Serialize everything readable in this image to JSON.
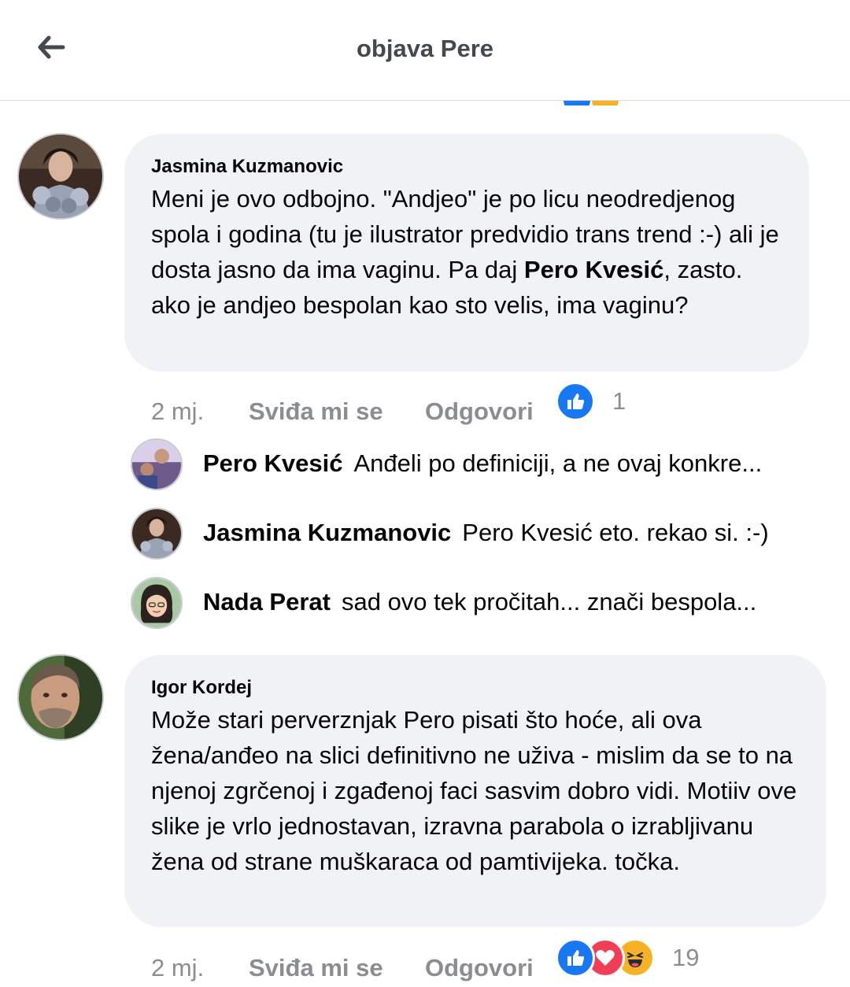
{
  "header": {
    "title": "objava Pere",
    "back_icon": "arrow-left-icon"
  },
  "comments": [
    {
      "author": "Jasmina Kuzmanovic",
      "text_before": "Meni je ovo odbojno. \"Andjeo\" je po licu neodredjenog spola i godina (tu je ilustrator predvidio trans trend :-) ali je dosta jasno da ima vaginu. Pa daj ",
      "mention": "Pero Kvesić",
      "text_after": ", zasto. ako je andjeo bespolan kao sto velis, ima vaginu?",
      "time": "2 mj.",
      "like_label": "Sviđa mi se",
      "reply_label": "Odgovori",
      "reaction_count": "1",
      "reactions": [
        "like-icon"
      ]
    },
    {
      "author": "Igor Kordej",
      "text": "Može stari perverznjak Pero pisati što hoće, ali ova žena/anđeo na slici definitivno ne uživa - mislim da se to na njenoj zgrčenoj i zgađenoj faci sasvim dobro vidi. Motiiv ove slike je vrlo jednostavan, izravna parabola o izrabljivanu žena od strane muškaraca od pamtivijeka. točka.",
      "time": "2 mj.",
      "like_label": "Sviđa mi se",
      "reply_label": "Odgovori",
      "reaction_count": "19",
      "reactions": [
        "like-icon",
        "love-icon",
        "haha-icon"
      ]
    }
  ],
  "replies": [
    {
      "author": "Pero Kvesić",
      "text": "Anđeli po definiciji, a ne ovaj konkre..."
    },
    {
      "author": "Jasmina Kuzmanovic",
      "text": "Pero Kvesić eto. rekao si. :-)"
    },
    {
      "author": "Nada Perat",
      "text": "sad ovo tek pročitah... znači bespola..."
    }
  ],
  "colors": {
    "like_blue": "#1877f2",
    "love_red": "#f33e58",
    "haha_yellow": "#f7b125",
    "bubble_bg": "#f0f2f5",
    "meta_gray": "#8a8d91"
  }
}
